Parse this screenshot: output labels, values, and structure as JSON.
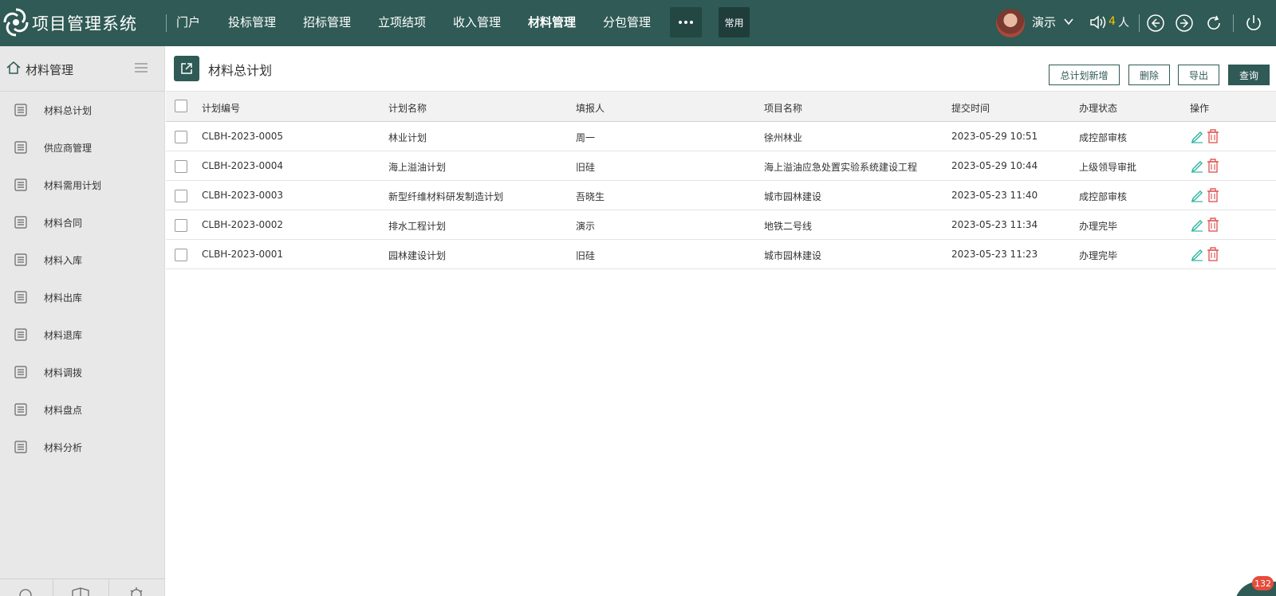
{
  "topbar": {
    "app_title": "项目管理系统",
    "nav": [
      "门户",
      "投标管理",
      "招标管理",
      "立项结项",
      "收入管理",
      "材料管理",
      "分包管理"
    ],
    "active_nav": "材料管理",
    "common_label": "常用",
    "user_name": "演示",
    "online_count": "4",
    "online_unit": "人"
  },
  "sidebar": {
    "title": "材料管理",
    "items": [
      "材料总计划",
      "供应商管理",
      "材料需用计划",
      "材料合同",
      "材料入库",
      "材料出库",
      "材料退库",
      "材料调拨",
      "材料盘点",
      "材料分析"
    ]
  },
  "page": {
    "title": "材料总计划",
    "buttons": {
      "add": "总计划新增",
      "delete": "删除",
      "export": "导出",
      "query": "查询"
    }
  },
  "table": {
    "columns": [
      "计划编号",
      "计划名称",
      "填报人",
      "项目名称",
      "提交时间",
      "办理状态",
      "操作"
    ],
    "rows": [
      [
        "CLBH-2023-0005",
        "林业计划",
        "周一",
        "徐州林业",
        "2023-05-29 10:51",
        "成控部审核"
      ],
      [
        "CLBH-2023-0004",
        "海上溢油计划",
        "旧硅",
        "海上溢油应急处置实验系统建设工程",
        "2023-05-29 10:44",
        "上级领导审批"
      ],
      [
        "CLBH-2023-0003",
        "新型纤维材料研发制造计划",
        "吾晓生",
        "城市园林建设",
        "2023-05-23 11:40",
        "成控部审核"
      ],
      [
        "CLBH-2023-0002",
        "排水工程计划",
        "演示",
        "地铁二号线",
        "2023-05-23 11:34",
        "办理完毕"
      ],
      [
        "CLBH-2023-0001",
        "园林建设计划",
        "旧硅",
        "城市园林建设",
        "2023-05-23 11:23",
        "办理完毕"
      ]
    ]
  },
  "notification_badge": "132",
  "colors": {
    "brand": "#2f5a55",
    "edit_icon": "#2bb5a0",
    "delete_icon": "#e05a5a",
    "badge": "#e74c3c"
  }
}
